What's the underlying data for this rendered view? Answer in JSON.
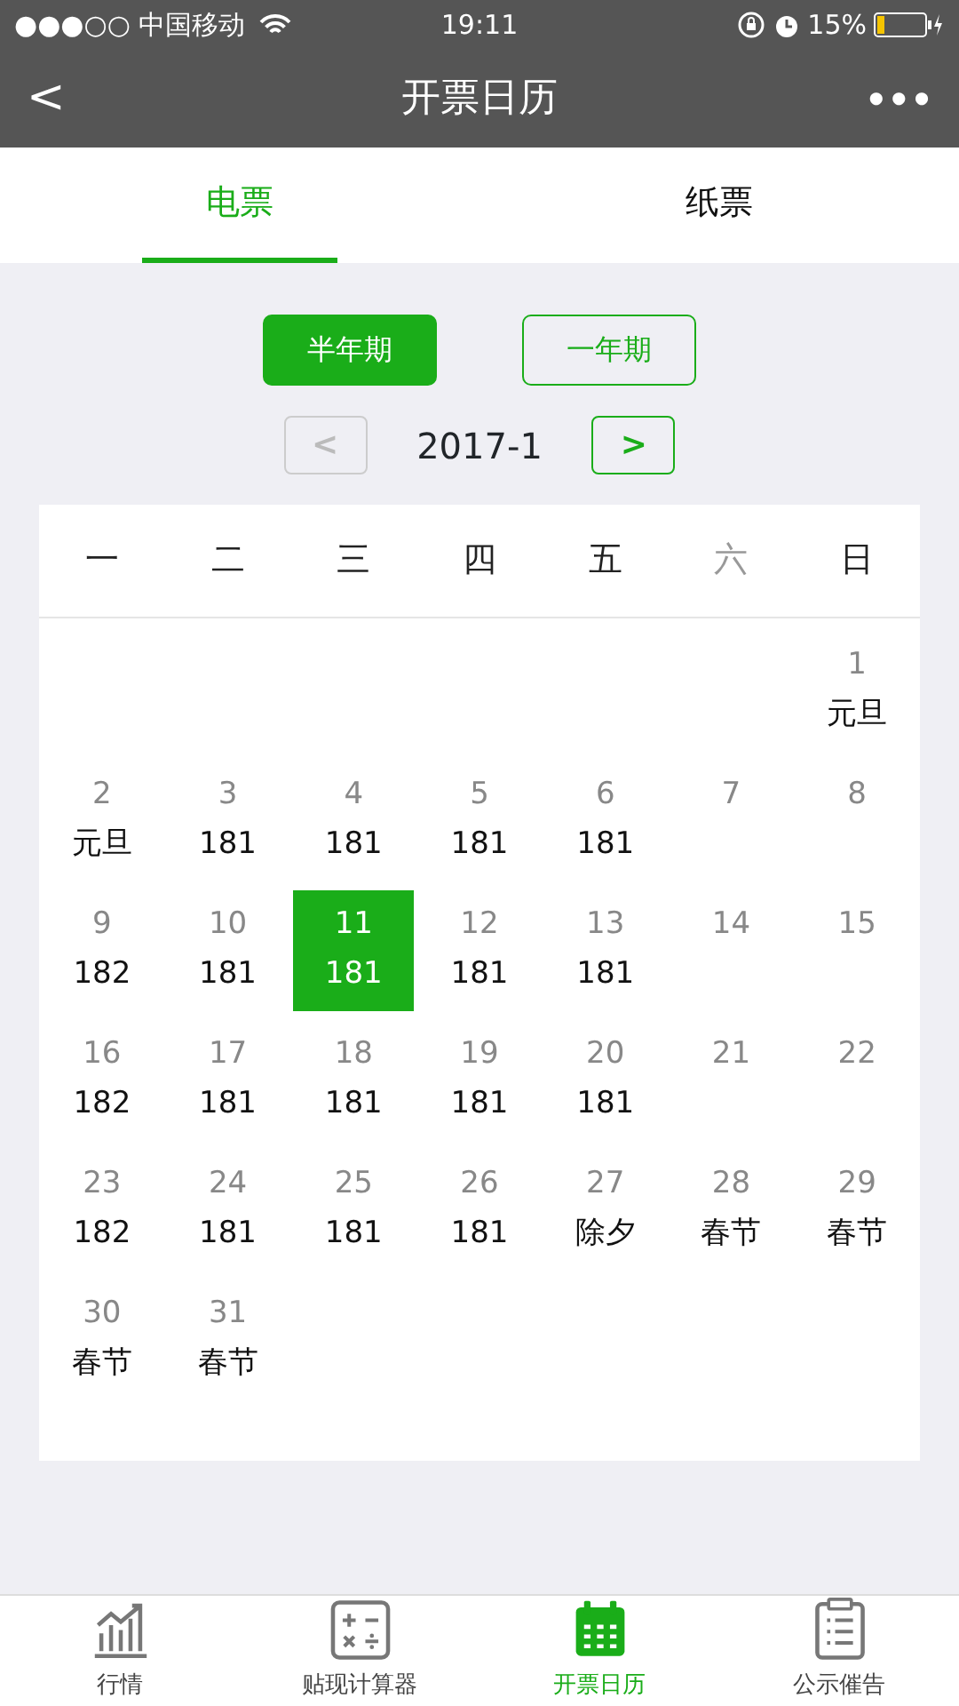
{
  "status_bar": {
    "carrier": "●●●○○ 中国移动",
    "time": "19:11",
    "battery": "15%"
  },
  "nav_bar": {
    "back": "<",
    "title": "开票日历",
    "more": "•••"
  },
  "tabs": [
    {
      "label": "电票",
      "selected": true
    },
    {
      "label": "纸票",
      "selected": false
    }
  ],
  "periods": [
    {
      "label": "半年期",
      "selected": true
    },
    {
      "label": "一年期",
      "selected": false
    }
  ],
  "month_nav": {
    "prev": "<",
    "prev_disabled": true,
    "month": "2017-1",
    "next": ">",
    "next_disabled": false
  },
  "calendar": {
    "weekdays": [
      {
        "label": "一",
        "weekend": false
      },
      {
        "label": "二",
        "weekend": false
      },
      {
        "label": "三",
        "weekend": false
      },
      {
        "label": "四",
        "weekend": false
      },
      {
        "label": "五",
        "weekend": false
      },
      {
        "label": "六",
        "weekend": true
      },
      {
        "label": "日",
        "weekend": false
      }
    ],
    "weeks": [
      [
        {
          "kind": "blank"
        },
        {
          "kind": "blank"
        },
        {
          "kind": "blank"
        },
        {
          "kind": "blank"
        },
        {
          "kind": "blank"
        },
        {
          "kind": "blank"
        },
        {
          "kind": "day",
          "day": "1",
          "note": "元旦",
          "selected": false
        }
      ],
      [
        {
          "kind": "day",
          "day": "2",
          "note": "元旦",
          "selected": false
        },
        {
          "kind": "day",
          "day": "3",
          "note": "181",
          "selected": false
        },
        {
          "kind": "day",
          "day": "4",
          "note": "181",
          "selected": false
        },
        {
          "kind": "day",
          "day": "5",
          "note": "181",
          "selected": false
        },
        {
          "kind": "day",
          "day": "6",
          "note": "181",
          "selected": false
        },
        {
          "kind": "day",
          "day": "7",
          "selected": false
        },
        {
          "kind": "day",
          "day": "8",
          "selected": false
        }
      ],
      [
        {
          "kind": "day",
          "day": "9",
          "note": "182",
          "selected": false
        },
        {
          "kind": "day",
          "day": "10",
          "note": "181",
          "selected": false
        },
        {
          "kind": "day",
          "day": "11",
          "note": "181",
          "selected": true
        },
        {
          "kind": "day",
          "day": "12",
          "note": "181",
          "selected": false
        },
        {
          "kind": "day",
          "day": "13",
          "note": "181",
          "selected": false
        },
        {
          "kind": "day",
          "day": "14",
          "selected": false
        },
        {
          "kind": "day",
          "day": "15",
          "selected": false
        }
      ],
      [
        {
          "kind": "day",
          "day": "16",
          "note": "182",
          "selected": false
        },
        {
          "kind": "day",
          "day": "17",
          "note": "181",
          "selected": false
        },
        {
          "kind": "day",
          "day": "18",
          "note": "181",
          "selected": false
        },
        {
          "kind": "day",
          "day": "19",
          "note": "181",
          "selected": false
        },
        {
          "kind": "day",
          "day": "20",
          "note": "181",
          "selected": false
        },
        {
          "kind": "day",
          "day": "21",
          "selected": false
        },
        {
          "kind": "day",
          "day": "22",
          "selected": false
        }
      ],
      [
        {
          "kind": "day",
          "day": "23",
          "note": "182",
          "selected": false
        },
        {
          "kind": "day",
          "day": "24",
          "note": "181",
          "selected": false
        },
        {
          "kind": "day",
          "day": "25",
          "note": "181",
          "selected": false
        },
        {
          "kind": "day",
          "day": "26",
          "note": "181",
          "selected": false
        },
        {
          "kind": "day",
          "day": "27",
          "note": "除夕",
          "selected": false
        },
        {
          "kind": "day",
          "day": "28",
          "note": "春节",
          "selected": false
        },
        {
          "kind": "day",
          "day": "29",
          "note": "春节",
          "selected": false
        }
      ],
      [
        {
          "kind": "day",
          "day": "30",
          "note": "春节",
          "selected": false
        },
        {
          "kind": "day",
          "day": "31",
          "note": "春节",
          "selected": false
        },
        {
          "kind": "blank"
        },
        {
          "kind": "blank"
        },
        {
          "kind": "blank"
        },
        {
          "kind": "blank"
        },
        {
          "kind": "blank"
        }
      ]
    ]
  },
  "tab_bar": [
    {
      "label": "行情",
      "selected": false
    },
    {
      "label": "贴现计算器",
      "selected": false
    },
    {
      "label": "开票日历",
      "selected": true
    },
    {
      "label": "公示催告",
      "selected": false
    }
  ]
}
